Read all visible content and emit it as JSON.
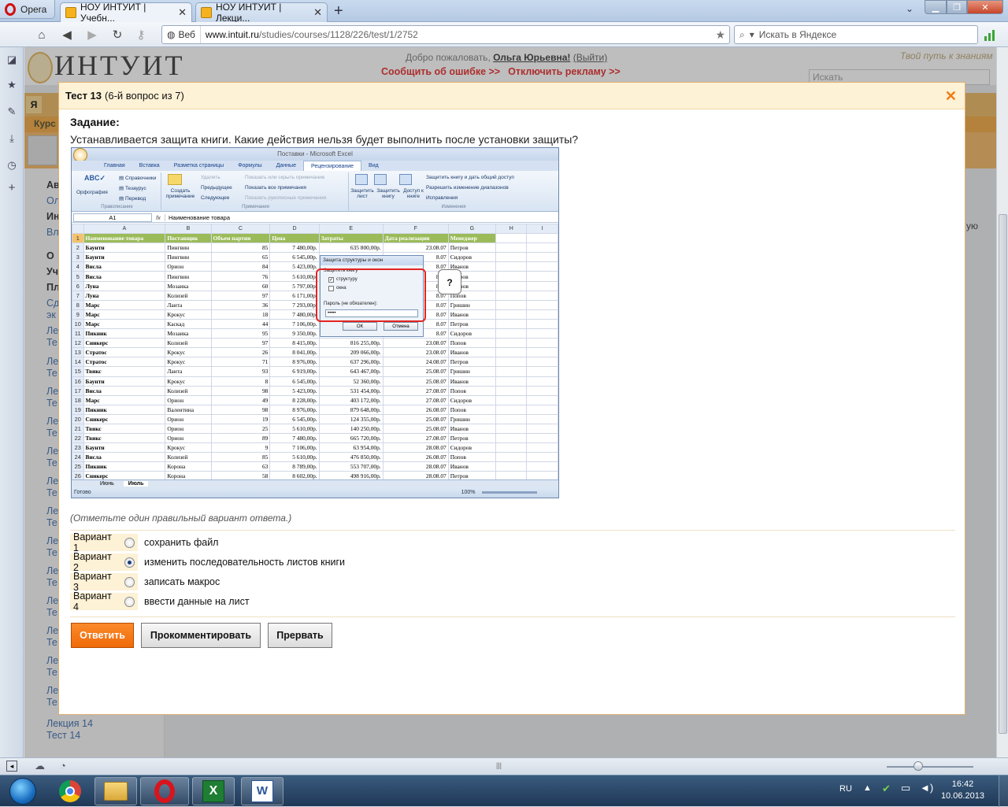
{
  "browser": {
    "opera_label": "Opera",
    "tabs": [
      {
        "label": "НОУ ИНТУИТ | Учебн..."
      },
      {
        "label": "НОУ ИНТУИТ | Лекци..."
      }
    ],
    "new_tab": "+",
    "web_badge": "Веб",
    "url_host": "www.intuit.ru",
    "url_path": "/studies/courses/1128/226/test/1/2752",
    "search_placeholder": "Искать в Яндексе"
  },
  "site": {
    "logo": "ИНТУИТ",
    "welcome": "Добро пожаловать,",
    "user": "Ольга Юрьевна!",
    "logout": "(Выйти)",
    "report_error": "Сообщить об ошибке >>",
    "disable_ads": "Отключить рекламу >>",
    "slogan": "Твой путь к знаниям",
    "search": "Искать",
    "nav_tab": "Я",
    "courses_label": "Курс",
    "sidebar_links": [
      "Лекция 14",
      "Тест 14"
    ],
    "left_letters": [
      "Ав",
      "Ол",
      "Ин",
      "Вл",
      "О",
      "Уч",
      "Пл",
      "Сд",
      "эк",
      "Ле",
      "Те",
      "Ле",
      "Те",
      "Ле",
      "Те",
      "Ле",
      "Те",
      "Ле",
      "Те",
      "Ле",
      "Те",
      "Ле",
      "Те",
      "Ле",
      "Те",
      "Ле",
      "Те",
      "Ле",
      "Те",
      "Ле",
      "Те",
      "Ле",
      "Те",
      "Ле",
      "Те"
    ],
    "right_fragment": "ую"
  },
  "test": {
    "title": "Тест 13",
    "subtitle": "(6-й вопрос из 7)",
    "task_label": "Задание:",
    "task_text": "Устанавливается защита книги. Какие действия нельзя будет выполнить после установки защиты?",
    "hint": "(Отметьте один правильный вариант ответа.)",
    "options": [
      {
        "label": "Вариант 1",
        "text": "сохранить файл",
        "selected": false
      },
      {
        "label": "Вариант 2",
        "text": "изменить последовательность листов книги",
        "selected": true
      },
      {
        "label": "Вариант 3",
        "text": "записать макрос",
        "selected": false
      },
      {
        "label": "Вариант 4",
        "text": "ввести данные на лист",
        "selected": false
      }
    ],
    "buttons": {
      "answer": "Ответить",
      "comment": "Прокомментировать",
      "abort": "Прервать"
    },
    "accent": "#f06a08"
  },
  "excel": {
    "title": "Поставки - Microsoft Excel",
    "tabs": [
      "Главная",
      "Вставка",
      "Разметка страницы",
      "Формулы",
      "Данные",
      "Рецензирование",
      "Вид"
    ],
    "active_tab": "Рецензирование",
    "ribbon": {
      "spelling": "Орфография",
      "refs": "Справочники",
      "thesaurus": "Тезаурус",
      "translate": "Перевод",
      "group_spelling": "Правописание",
      "new_note": "Создать примечание",
      "delete": "Удалить",
      "previous": "Предыдущее",
      "next": "Следующее",
      "show_hide_note": "Показать или скрыть примечание",
      "show_all_notes": "Показать все примечания",
      "show_ink": "Показать рукописные примечания",
      "group_notes": "Примечания",
      "protect_sheet": "Защитить лист",
      "protect_book": "Защитить книгу",
      "allow_access": "Доступ к книге",
      "protect_share": "Защитить книгу и дать общий доступ",
      "allow_ranges": "Разрешить изменение диапазонов",
      "track": "Исправления",
      "group_changes": "Изменения"
    },
    "namebox": "A1",
    "fx": "fx",
    "formula_value": "Наименование товара",
    "columns": [
      "A",
      "B",
      "C",
      "D",
      "E",
      "F",
      "G",
      "H",
      "I"
    ],
    "headers": [
      "Наименование товара",
      "Поставщик",
      "Объем партии",
      "Цена",
      "Затраты",
      "Дата реализации",
      "Менеджер"
    ],
    "rows": [
      [
        "Баунти",
        "Пингвин",
        "85",
        "7 480,00р.",
        "635 800,00р.",
        "23.08.07",
        "Петров"
      ],
      [
        "Баунти",
        "Пингвин",
        "65",
        "6 545,00р.",
        "",
        "8.07",
        "Сидоров"
      ],
      [
        "Висла",
        "Орион",
        "84",
        "5 423,00р.",
        "",
        "8.07",
        "Иванов"
      ],
      [
        "Висла",
        "Пингвин",
        "76",
        "5 610,00р.",
        "",
        "8.07",
        "Петров"
      ],
      [
        "Луна",
        "Мозаика",
        "60",
        "5 797,00р.",
        "",
        "8.07",
        "Иванов"
      ],
      [
        "Луна",
        "Колизей",
        "97",
        "6 171,00р.",
        "",
        "8.07",
        "Попов"
      ],
      [
        "Марс",
        "Ланта",
        "36",
        "7 293,00р.",
        "",
        "8.07",
        "Гришин"
      ],
      [
        "Марс",
        "Крокус",
        "18",
        "7 480,00р.",
        "",
        "8.07",
        "Иванов"
      ],
      [
        "Марс",
        "Каскад",
        "44",
        "7 106,00р.",
        "",
        "8.07",
        "Петров"
      ],
      [
        "Пикник",
        "Мозаика",
        "95",
        "9 350,00р.",
        "",
        "8.07",
        "Сидоров"
      ],
      [
        "Сникерс",
        "Колизей",
        "97",
        "8 415,00р.",
        "816 255,00р.",
        "23.08.07",
        "Попов"
      ],
      [
        "Стратос",
        "Крокус",
        "26",
        "8 041,00р.",
        "209 066,00р.",
        "23.08.07",
        "Иванов"
      ],
      [
        "Стратос",
        "Крокус",
        "71",
        "8 976,00р.",
        "637 296,00р.",
        "24.08.07",
        "Петров"
      ],
      [
        "Твикс",
        "Ланта",
        "93",
        "6 919,00р.",
        "643 467,00р.",
        "25.08.07",
        "Гришин"
      ],
      [
        "Баунти",
        "Крокус",
        "8",
        "6 545,00р.",
        "52 360,00р.",
        "25.08.07",
        "Иванов"
      ],
      [
        "Висла",
        "Колизей",
        "98",
        "5 423,00р.",
        "531 454,00р.",
        "27.08.07",
        "Попов"
      ],
      [
        "Марс",
        "Орион",
        "49",
        "8 228,00р.",
        "403 172,00р.",
        "27.08.07",
        "Сидоров"
      ],
      [
        "Пикник",
        "Валентина",
        "98",
        "8 976,00р.",
        "879 648,00р.",
        "26.08.07",
        "Попов"
      ],
      [
        "Сникерс",
        "Орион",
        "19",
        "6 545,00р.",
        "124 355,00р.",
        "25.08.07",
        "Гришин"
      ],
      [
        "Твикс",
        "Орион",
        "25",
        "5 610,00р.",
        "140 250,00р.",
        "25.08.07",
        "Иванов"
      ],
      [
        "Твикс",
        "Орион",
        "89",
        "7 480,00р.",
        "665 720,00р.",
        "27.08.07",
        "Петров"
      ],
      [
        "Баунти",
        "Крокус",
        "9",
        "7 106,00р.",
        "63 954,00р.",
        "28.08.07",
        "Сидоров"
      ],
      [
        "Висла",
        "Колизей",
        "85",
        "5 610,00р.",
        "476 850,00р.",
        "26.08.07",
        "Попов"
      ],
      [
        "Пикник",
        "Корона",
        "63",
        "8 789,00р.",
        "553 707,00р.",
        "28.08.07",
        "Иванов"
      ],
      [
        "Сникерс",
        "Корона",
        "58",
        "8 602,00р.",
        "498 916,00р.",
        "28.08.07",
        "Петров"
      ]
    ],
    "sheet_tabs": [
      "Июнь",
      "Июль"
    ],
    "status_ready": "Готово",
    "zoom": "100%",
    "dialog": {
      "title": "Защита структуры и окон",
      "group": "Защитить книгу",
      "structure": "структуру",
      "windows": "окна",
      "password_label": "Пароль (не обязателен):",
      "password_value": "•••••",
      "ok": "ОК",
      "cancel": "Отмена"
    },
    "callout": "?"
  },
  "taskbar": {
    "lang": "RU",
    "time": "16:42",
    "date": "10.06.2013"
  }
}
